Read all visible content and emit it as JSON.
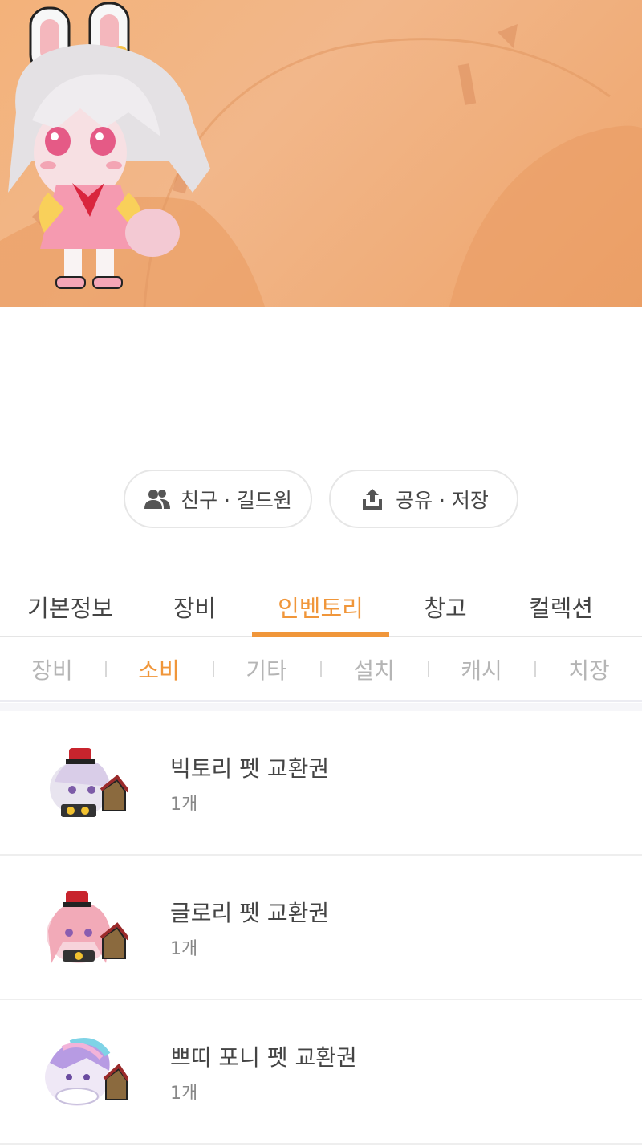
{
  "colors": {
    "accent": "#f0963a",
    "hero_bg": "#f2b485",
    "text_primary": "#444444",
    "text_muted": "#b5b5b5"
  },
  "actions": {
    "friends_label": "친구 · 길드원",
    "friends_icon": "people-icon",
    "share_label": "공유 · 저장",
    "share_icon": "share-upload-icon"
  },
  "tabs": [
    {
      "label": "기본정보",
      "active": false
    },
    {
      "label": "장비",
      "active": false
    },
    {
      "label": "인벤토리",
      "active": true
    },
    {
      "label": "창고",
      "active": false
    },
    {
      "label": "컬렉션",
      "active": false
    }
  ],
  "subtabs": [
    {
      "label": "장비",
      "active": false
    },
    {
      "label": "소비",
      "active": true
    },
    {
      "label": "기타",
      "active": false
    },
    {
      "label": "설치",
      "active": false
    },
    {
      "label": "캐시",
      "active": false
    },
    {
      "label": "치장",
      "active": false
    }
  ],
  "items": [
    {
      "name": "빅토리 펫 교환권",
      "qty": "1개",
      "icon": "victory-pet-icon"
    },
    {
      "name": "글로리 펫 교환권",
      "qty": "1개",
      "icon": "glory-pet-icon"
    },
    {
      "name": "쁘띠 포니 펫 교환권",
      "qty": "1개",
      "icon": "petit-pony-pet-icon"
    }
  ]
}
